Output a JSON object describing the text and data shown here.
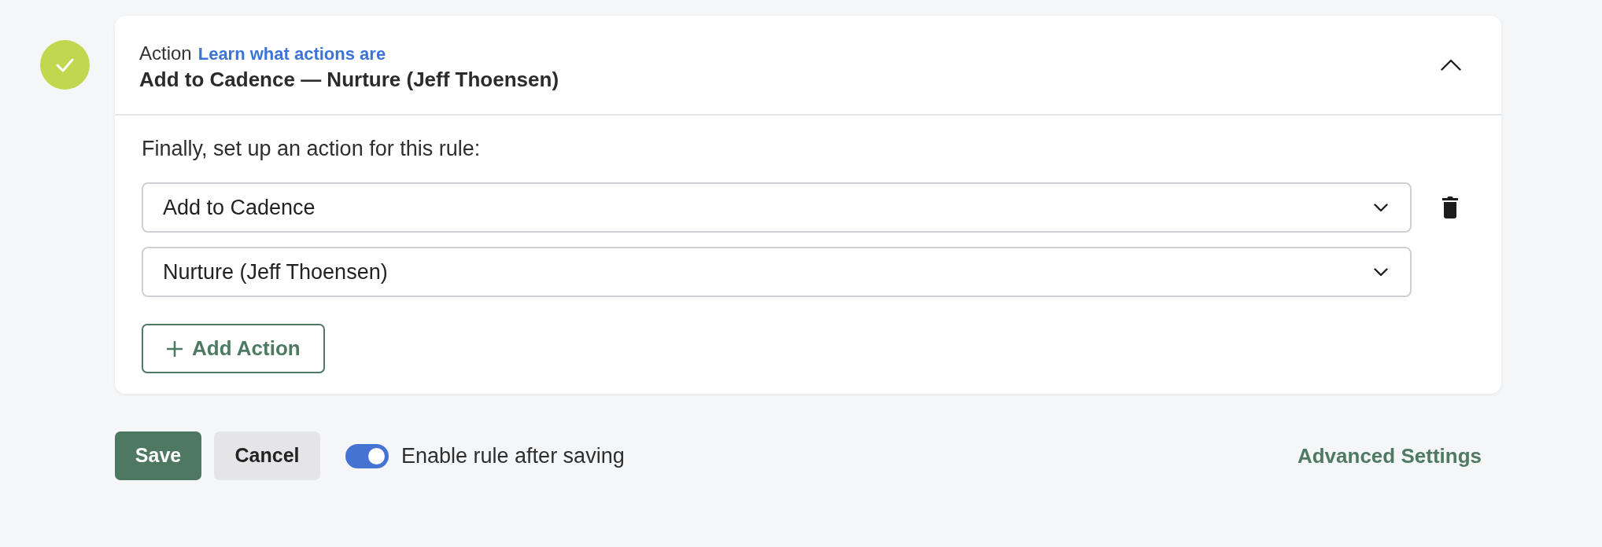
{
  "step": {
    "completed": true
  },
  "card": {
    "header": {
      "label": "Action",
      "link": "Learn what actions are",
      "title": "Add to Cadence — Nurture (Jeff Thoensen)",
      "expanded": true
    },
    "body": {
      "prompt": "Finally, set up an action for this rule:",
      "actions": [
        {
          "selects": [
            "Add to Cadence",
            "Nurture (Jeff Thoensen)"
          ]
        }
      ],
      "add_button": "Add Action"
    }
  },
  "footer": {
    "save_button": "Save",
    "cancel_button": "Cancel",
    "toggle": {
      "label": "Enable rule after saving",
      "on": true
    },
    "advanced_link": "Advanced Settings"
  }
}
